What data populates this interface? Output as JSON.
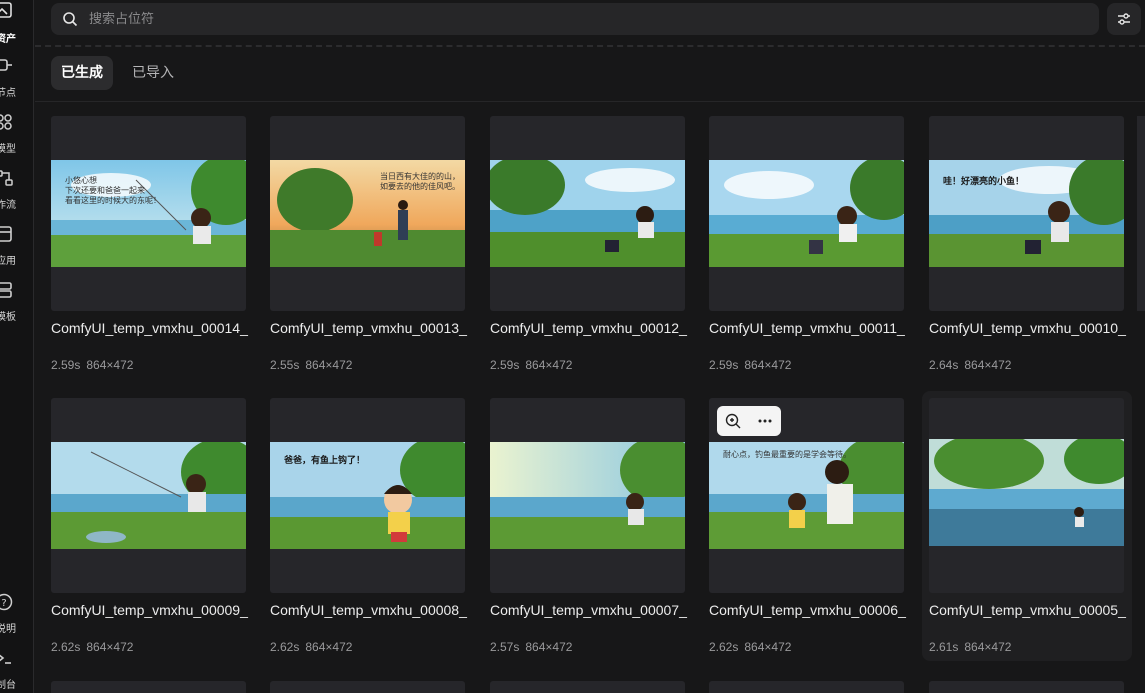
{
  "sidebar": {
    "items": [
      {
        "label": "资产",
        "icon": "assets-icon",
        "active": true
      },
      {
        "label": "节点",
        "icon": "node-icon",
        "active": false
      },
      {
        "label": "模型",
        "icon": "model-icon",
        "active": false
      },
      {
        "label": "工作流",
        "icon": "workflow-icon",
        "active": false
      },
      {
        "label": "应用",
        "icon": "app-icon",
        "active": false
      },
      {
        "label": "模板",
        "icon": "template-icon",
        "active": false
      }
    ],
    "bottom": [
      {
        "label": "说明",
        "icon": "help-icon"
      },
      {
        "label": "控制台",
        "icon": "console-icon"
      }
    ]
  },
  "search": {
    "placeholder": "搜索占位符",
    "value": ""
  },
  "tabs": [
    {
      "label": "已生成",
      "active": true
    },
    {
      "label": "已导入",
      "active": false
    }
  ],
  "assets": [
    {
      "name": "ComfyUI_temp_vmxhu_00014_",
      "duration": "2.59s",
      "size": "864×472",
      "caption": "小悠心想\n下次还要和爸爸一起来\n看看这里的时候大的东呢！"
    },
    {
      "name": "ComfyUI_temp_vmxhu_00013_",
      "duration": "2.55s",
      "size": "864×472",
      "caption": "当日西有大佳的的山，\n如要去的他的佳风吧。"
    },
    {
      "name": "ComfyUI_temp_vmxhu_00012_",
      "duration": "2.59s",
      "size": "864×472",
      "caption": ""
    },
    {
      "name": "ComfyUI_temp_vmxhu_00011_",
      "duration": "2.59s",
      "size": "864×472",
      "caption": ""
    },
    {
      "name": "ComfyUI_temp_vmxhu_00010_",
      "duration": "2.64s",
      "size": "864×472",
      "caption": "哇！好漂亮的小鱼！"
    },
    {
      "name": "ComfyUI_temp_vmxhu_00009_",
      "duration": "2.62s",
      "size": "864×472",
      "caption": ""
    },
    {
      "name": "ComfyUI_temp_vmxhu_00008_",
      "duration": "2.62s",
      "size": "864×472",
      "caption": "爸爸，有鱼上钩了！"
    },
    {
      "name": "ComfyUI_temp_vmxhu_00007_",
      "duration": "2.57s",
      "size": "864×472",
      "caption": ""
    },
    {
      "name": "ComfyUI_temp_vmxhu_00006_",
      "duration": "2.62s",
      "size": "864×472",
      "caption": "耐心点，钓鱼最重要的是学会等待。"
    },
    {
      "name": "ComfyUI_temp_vmxhu_00005_",
      "duration": "2.61s",
      "size": "864×472",
      "caption": ""
    }
  ],
  "colors": {
    "background": "#171718",
    "card": "#26262a",
    "accent_text": "#ffffff"
  }
}
